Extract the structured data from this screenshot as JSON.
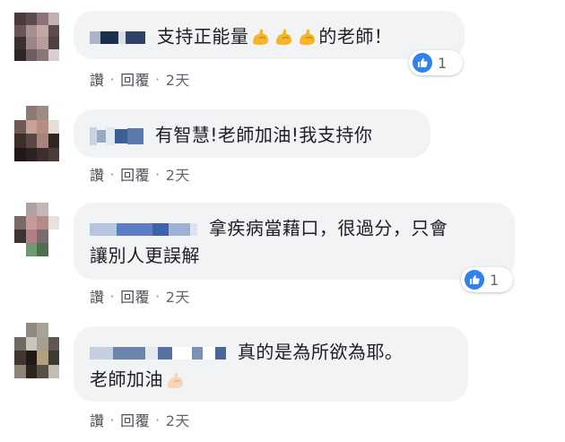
{
  "comments": [
    {
      "text": "支持正能量",
      "emoji_count": 3,
      "text_after": "的老師！",
      "actions": {
        "like": "讚",
        "reply": "回覆",
        "time": "2天"
      },
      "reaction_count": "1"
    },
    {
      "text": "有智慧!老師加油!我支持你",
      "actions": {
        "like": "讚",
        "reply": "回覆",
        "time": "2天"
      }
    },
    {
      "text_line1": "拿疾病當藉口，很過分，只會",
      "text_line2": "讓別人更誤解",
      "actions": {
        "like": "讚",
        "reply": "回覆",
        "time": "2天"
      },
      "reaction_count": "1"
    },
    {
      "text_line1": "真的是為所欲為耶。",
      "text_line2": "老師加油",
      "actions": {
        "like": "讚",
        "reply": "回覆",
        "time": "2天"
      }
    }
  ],
  "separator": "·",
  "icons": {
    "reaction": "like-thumb-icon",
    "emoji": "flexed-biceps-icon"
  },
  "colors": {
    "bubble": "#f2f3f5",
    "like_blue": "#2f82f0",
    "action_text": "#606770"
  }
}
